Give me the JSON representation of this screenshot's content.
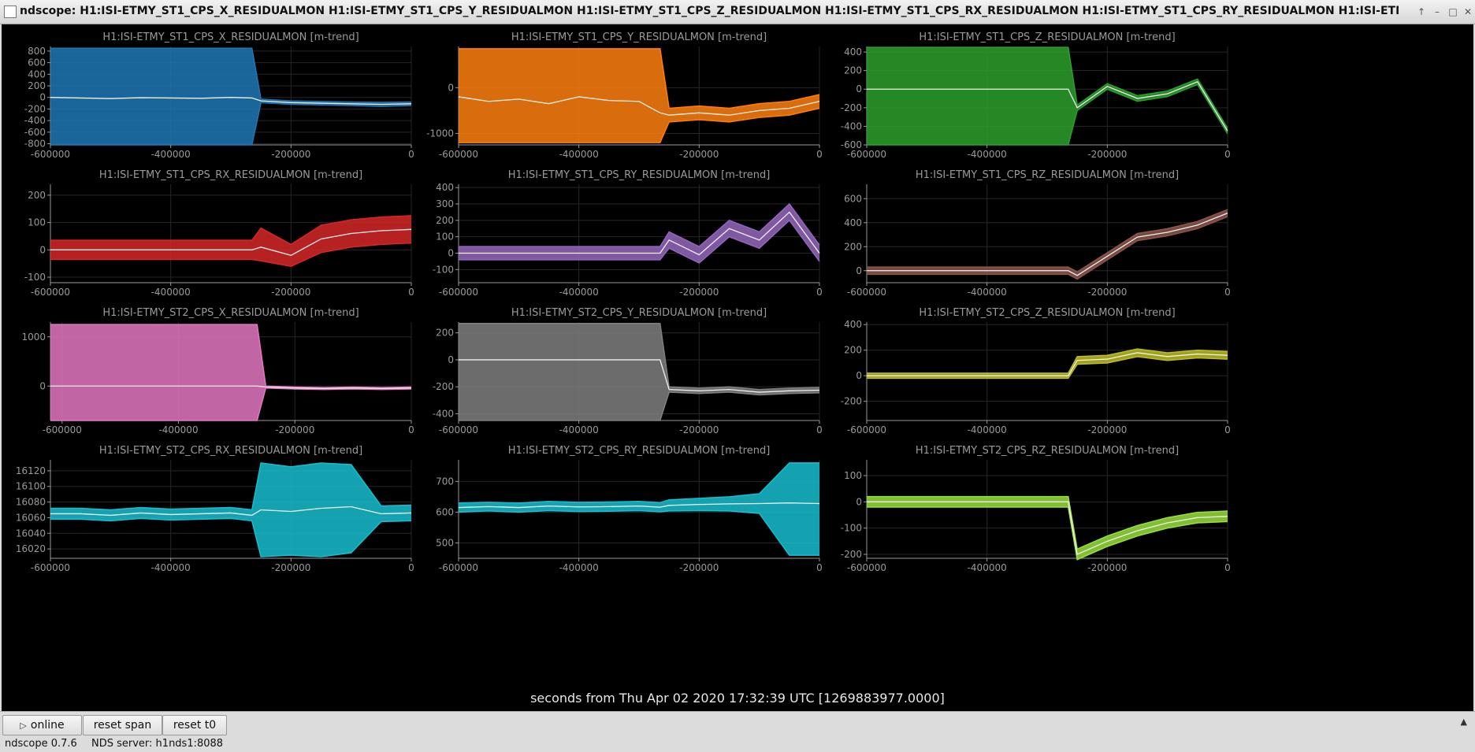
{
  "window": {
    "title": "ndscope: H1:ISI-ETMY_ST1_CPS_X_RESIDUALMON H1:ISI-ETMY_ST1_CPS_Y_RESIDUALMON H1:ISI-ETMY_ST1_CPS_Z_RESIDUALMON H1:ISI-ETMY_ST1_CPS_RX_RESIDUALMON H1:ISI-ETMY_ST1_CPS_RY_RESIDUALMON H1:ISI-ETMY_ST1_CPS_RZ",
    "controls": [
      "↑",
      "–",
      "□",
      "✕"
    ]
  },
  "plots": {
    "x_axis_label": "seconds from Thu Apr 02 2020 17:32:39 UTC [1269883977.0000]"
  },
  "chart_data": [
    {
      "type": "line",
      "title": "H1:ISI-ETMY_ST1_CPS_X_RESIDUALMON [m-trend]",
      "color": "#1f77b4",
      "xlim": [
        -600000,
        0
      ],
      "ylim": [
        -820,
        880
      ],
      "xticks": [
        -600000,
        -400000,
        -200000,
        0
      ],
      "yticks": [
        -800,
        -600,
        -400,
        -200,
        0,
        200,
        400,
        600,
        800
      ],
      "x": [
        -600000,
        -550000,
        -500000,
        -450000,
        -400000,
        -350000,
        -300000,
        -265000,
        -250000,
        -200000,
        -150000,
        -100000,
        -50000,
        0
      ],
      "mean": [
        0,
        -10,
        -20,
        -5,
        -10,
        -15,
        0,
        -10,
        -60,
        -90,
        -100,
        -110,
        -120,
        -110
      ],
      "upper": [
        850,
        850,
        850,
        850,
        850,
        850,
        850,
        850,
        -30,
        -60,
        -70,
        -80,
        -85,
        -80
      ],
      "lower": [
        -820,
        -820,
        -820,
        -820,
        -820,
        -820,
        -820,
        -820,
        -90,
        -120,
        -130,
        -140,
        -155,
        -140
      ]
    },
    {
      "type": "line",
      "title": "H1:ISI-ETMY_ST1_CPS_Y_RESIDUALMON [m-trend]",
      "color": "#ff7f0e",
      "xlim": [
        -600000,
        0
      ],
      "ylim": [
        -1250,
        900
      ],
      "xticks": [
        -600000,
        -400000,
        -200000,
        0
      ],
      "yticks": [
        -1000,
        0
      ],
      "x": [
        -600000,
        -550000,
        -500000,
        -450000,
        -400000,
        -350000,
        -300000,
        -265000,
        -250000,
        -200000,
        -150000,
        -100000,
        -50000,
        0
      ],
      "mean": [
        -200,
        -300,
        -250,
        -350,
        -200,
        -280,
        -300,
        -550,
        -600,
        -550,
        -600,
        -500,
        -450,
        -300
      ],
      "upper": [
        850,
        850,
        850,
        850,
        850,
        850,
        850,
        850,
        -450,
        -400,
        -450,
        -350,
        -300,
        -150
      ],
      "lower": [
        -1200,
        -1200,
        -1200,
        -1200,
        -1200,
        -1200,
        -1200,
        -1200,
        -750,
        -700,
        -750,
        -650,
        -600,
        -450
      ]
    },
    {
      "type": "line",
      "title": "H1:ISI-ETMY_ST1_CPS_Z_RESIDUALMON [m-trend]",
      "color": "#2ca02c",
      "xlim": [
        -600000,
        0
      ],
      "ylim": [
        -600,
        460
      ],
      "xticks": [
        -600000,
        -400000,
        -200000,
        0
      ],
      "yticks": [
        -600,
        -400,
        -200,
        0,
        200,
        400
      ],
      "x": [
        -600000,
        -550000,
        -500000,
        -450000,
        -400000,
        -350000,
        -300000,
        -265000,
        -250000,
        -200000,
        -150000,
        -100000,
        -50000,
        0
      ],
      "mean": [
        0,
        0,
        0,
        0,
        0,
        0,
        0,
        0,
        -200,
        30,
        -100,
        -50,
        80,
        -450
      ],
      "upper": [
        450,
        450,
        450,
        450,
        450,
        450,
        450,
        450,
        -170,
        60,
        -70,
        -20,
        110,
        -420
      ],
      "lower": [
        -600,
        -600,
        -600,
        -600,
        -600,
        -600,
        -600,
        -600,
        -230,
        0,
        -130,
        -80,
        50,
        -480
      ]
    },
    {
      "type": "line",
      "title": "H1:ISI-ETMY_ST1_CPS_RX_RESIDUALMON [m-trend]",
      "color": "#d62728",
      "xlim": [
        -600000,
        0
      ],
      "ylim": [
        -120,
        240
      ],
      "xticks": [
        -600000,
        -400000,
        -200000,
        0
      ],
      "yticks": [
        -100,
        0,
        100,
        200
      ],
      "x": [
        -600000,
        -550000,
        -500000,
        -450000,
        -400000,
        -350000,
        -300000,
        -265000,
        -250000,
        -200000,
        -150000,
        -100000,
        -50000,
        0
      ],
      "mean": [
        0,
        0,
        0,
        0,
        0,
        0,
        0,
        0,
        10,
        -20,
        40,
        60,
        70,
        75
      ],
      "upper": [
        35,
        35,
        35,
        35,
        35,
        35,
        35,
        35,
        80,
        20,
        90,
        110,
        120,
        125
      ],
      "lower": [
        -35,
        -35,
        -35,
        -35,
        -35,
        -35,
        -35,
        -35,
        -40,
        -60,
        -10,
        10,
        20,
        25
      ]
    },
    {
      "type": "line",
      "title": "H1:ISI-ETMY_ST1_CPS_RY_RESIDUALMON [m-trend]",
      "color": "#9467bd",
      "xlim": [
        -600000,
        0
      ],
      "ylim": [
        -180,
        420
      ],
      "xticks": [
        -600000,
        -400000,
        -200000,
        0
      ],
      "yticks": [
        -100,
        0,
        100,
        200,
        300,
        400
      ],
      "x": [
        -600000,
        -550000,
        -500000,
        -450000,
        -400000,
        -350000,
        -300000,
        -265000,
        -250000,
        -200000,
        -150000,
        -100000,
        -50000,
        0
      ],
      "mean": [
        0,
        0,
        0,
        0,
        0,
        0,
        0,
        0,
        80,
        -10,
        150,
        80,
        250,
        0
      ],
      "upper": [
        40,
        40,
        40,
        40,
        40,
        40,
        40,
        40,
        130,
        40,
        200,
        130,
        300,
        50
      ],
      "lower": [
        -40,
        -40,
        -40,
        -40,
        -40,
        -40,
        -40,
        -40,
        30,
        -60,
        100,
        30,
        200,
        -50
      ]
    },
    {
      "type": "line",
      "title": "H1:ISI-ETMY_ST1_CPS_RZ_RESIDUALMON [m-trend]",
      "color": "#8c564b",
      "xlim": [
        -600000,
        0
      ],
      "ylim": [
        -100,
        720
      ],
      "xticks": [
        -600000,
        -400000,
        -200000,
        0
      ],
      "yticks": [
        0,
        200,
        400,
        600
      ],
      "x": [
        -600000,
        -550000,
        -500000,
        -450000,
        -400000,
        -350000,
        -300000,
        -265000,
        -250000,
        -200000,
        -150000,
        -100000,
        -50000,
        0
      ],
      "mean": [
        0,
        0,
        0,
        0,
        0,
        0,
        0,
        0,
        -40,
        120,
        280,
        320,
        380,
        480
      ],
      "upper": [
        30,
        30,
        30,
        30,
        30,
        30,
        30,
        30,
        -10,
        150,
        310,
        350,
        410,
        510
      ],
      "lower": [
        -30,
        -30,
        -30,
        -30,
        -30,
        -30,
        -30,
        -30,
        -70,
        90,
        250,
        290,
        350,
        450
      ]
    },
    {
      "type": "line",
      "title": "H1:ISI-ETMY_ST2_CPS_X_RESIDUALMON [m-trend]",
      "color": "#e377c2",
      "xlim": [
        -620000,
        0
      ],
      "ylim": [
        -700,
        1300
      ],
      "xticks": [
        -600000,
        -400000,
        -200000,
        0
      ],
      "yticks": [
        0,
        1000
      ],
      "x": [
        -620000,
        -550000,
        -500000,
        -450000,
        -400000,
        -350000,
        -300000,
        -265000,
        -250000,
        -200000,
        -150000,
        -100000,
        -50000,
        0
      ],
      "mean": [
        0,
        0,
        0,
        0,
        0,
        0,
        0,
        0,
        -20,
        -40,
        -50,
        -40,
        -50,
        -40
      ],
      "upper": [
        1250,
        1250,
        1250,
        1250,
        1250,
        1250,
        1250,
        1250,
        0,
        -20,
        -30,
        -20,
        -30,
        -20
      ],
      "lower": [
        -700,
        -700,
        -700,
        -700,
        -700,
        -700,
        -700,
        -700,
        -40,
        -60,
        -70,
        -60,
        -70,
        -60
      ]
    },
    {
      "type": "line",
      "title": "H1:ISI-ETMY_ST2_CPS_Y_RESIDUALMON [m-trend]",
      "color": "#7f7f7f",
      "xlim": [
        -600000,
        0
      ],
      "ylim": [
        -450,
        280
      ],
      "xticks": [
        -600000,
        -400000,
        -200000,
        0
      ],
      "yticks": [
        -400,
        -200,
        0,
        200
      ],
      "x": [
        -600000,
        -550000,
        -500000,
        -450000,
        -400000,
        -350000,
        -300000,
        -265000,
        -250000,
        -200000,
        -150000,
        -100000,
        -50000,
        0
      ],
      "mean": [
        0,
        0,
        0,
        0,
        0,
        0,
        0,
        0,
        -220,
        -230,
        -220,
        -240,
        -230,
        -225
      ],
      "upper": [
        270,
        270,
        270,
        270,
        270,
        270,
        270,
        270,
        -200,
        -210,
        -200,
        -220,
        -210,
        -205
      ],
      "lower": [
        -450,
        -450,
        -450,
        -450,
        -450,
        -450,
        -450,
        -450,
        -240,
        -250,
        -240,
        -260,
        -250,
        -245
      ]
    },
    {
      "type": "line",
      "title": "H1:ISI-ETMY_ST2_CPS_Z_RESIDUALMON [m-trend]",
      "color": "#bcbd22",
      "xlim": [
        -600000,
        0
      ],
      "ylim": [
        -350,
        420
      ],
      "xticks": [
        -600000,
        -400000,
        -200000,
        0
      ],
      "yticks": [
        -200,
        0,
        200,
        400
      ],
      "x": [
        -600000,
        -550000,
        -500000,
        -450000,
        -400000,
        -350000,
        -300000,
        -265000,
        -250000,
        -200000,
        -150000,
        -100000,
        -50000,
        0
      ],
      "mean": [
        0,
        0,
        0,
        0,
        0,
        0,
        0,
        0,
        120,
        130,
        180,
        150,
        170,
        160
      ],
      "upper": [
        20,
        20,
        20,
        20,
        20,
        20,
        20,
        20,
        150,
        160,
        210,
        180,
        200,
        190
      ],
      "lower": [
        -20,
        -20,
        -20,
        -20,
        -20,
        -20,
        -20,
        -20,
        90,
        100,
        150,
        120,
        140,
        130
      ]
    },
    {
      "type": "line",
      "title": "H1:ISI-ETMY_ST2_CPS_RX_RESIDUALMON [m-trend]",
      "color": "#17becf",
      "xlim": [
        -600000,
        0
      ],
      "ylim": [
        16008,
        16134
      ],
      "xticks": [
        -600000,
        -400000,
        -200000,
        0
      ],
      "yticks": [
        16020,
        16040,
        16060,
        16080,
        16100,
        16120
      ],
      "x": [
        -600000,
        -550000,
        -500000,
        -450000,
        -400000,
        -350000,
        -300000,
        -265000,
        -250000,
        -200000,
        -150000,
        -100000,
        -50000,
        0
      ],
      "mean": [
        16065,
        16065,
        16063,
        16066,
        16064,
        16065,
        16066,
        16063,
        16070,
        16068,
        16072,
        16074,
        16065,
        16066
      ],
      "upper": [
        16072,
        16072,
        16070,
        16073,
        16071,
        16072,
        16073,
        16070,
        16130,
        16125,
        16130,
        16128,
        16075,
        16076
      ],
      "lower": [
        16058,
        16058,
        16056,
        16059,
        16057,
        16058,
        16059,
        16056,
        16010,
        16012,
        16010,
        16015,
        16055,
        16056
      ]
    },
    {
      "type": "line",
      "title": "H1:ISI-ETMY_ST2_CPS_RY_RESIDUALMON [m-trend]",
      "color": "#17becf",
      "xlim": [
        -600000,
        0
      ],
      "ylim": [
        450,
        770
      ],
      "xticks": [
        -600000,
        -400000,
        -200000,
        0
      ],
      "yticks": [
        500,
        600,
        700
      ],
      "x": [
        -600000,
        -550000,
        -500000,
        -450000,
        -400000,
        -350000,
        -300000,
        -265000,
        -250000,
        -200000,
        -150000,
        -100000,
        -50000,
        0
      ],
      "mean": [
        615,
        618,
        615,
        620,
        617,
        618,
        620,
        616,
        622,
        625,
        627,
        628,
        630,
        628
      ],
      "upper": [
        630,
        632,
        630,
        635,
        632,
        633,
        635,
        631,
        640,
        645,
        650,
        660,
        760,
        760
      ],
      "lower": [
        600,
        604,
        600,
        605,
        602,
        603,
        605,
        601,
        604,
        605,
        604,
        596,
        460,
        460
      ]
    },
    {
      "type": "line",
      "title": "H1:ISI-ETMY_ST2_CPS_RZ_RESIDUALMON [m-trend]",
      "color": "#98df3c",
      "xlim": [
        -600000,
        0
      ],
      "ylim": [
        -215,
        160
      ],
      "xticks": [
        -600000,
        -400000,
        -200000,
        0
      ],
      "yticks": [
        -200,
        -100,
        0,
        100
      ],
      "x": [
        -600000,
        -550000,
        -500000,
        -450000,
        -400000,
        -350000,
        -300000,
        -265000,
        -250000,
        -200000,
        -150000,
        -100000,
        -50000,
        0
      ],
      "mean": [
        0,
        0,
        0,
        0,
        0,
        0,
        0,
        0,
        -200,
        -150,
        -110,
        -80,
        -60,
        -55
      ],
      "upper": [
        20,
        20,
        20,
        20,
        20,
        20,
        20,
        20,
        -180,
        -130,
        -90,
        -60,
        -40,
        -35
      ],
      "lower": [
        -20,
        -20,
        -20,
        -20,
        -20,
        -20,
        -20,
        -20,
        -220,
        -170,
        -130,
        -100,
        -80,
        -75
      ]
    }
  ],
  "toolbar": {
    "online_icon": "play-icon",
    "online_label": "online",
    "reset_span_label": "reset span",
    "reset_t0_label": "reset t0",
    "collapse_glyph": "▲"
  },
  "status": {
    "version": "ndscope 0.7.6",
    "nds_server": "NDS server: h1nds1:8088"
  }
}
